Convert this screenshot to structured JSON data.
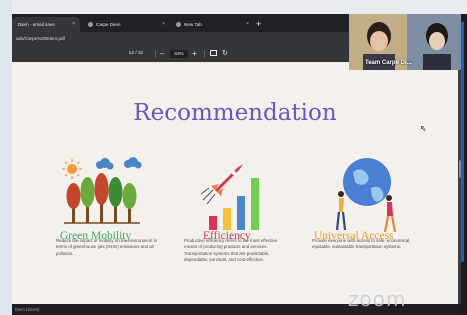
{
  "browser": {
    "tabs": [
      {
        "label": "Diem - email save",
        "active": true
      },
      {
        "label": "Carpe Diem",
        "active": false
      },
      {
        "label": "New Tab",
        "active": false
      }
    ],
    "address": "ads/Carpe%20Diem.pdf"
  },
  "pdf_toolbar": {
    "page": "12 / 31",
    "zoom": "63%"
  },
  "slide": {
    "title": "Recommendation",
    "columns": [
      {
        "heading": "Green Mobility",
        "heading_color": "#3aa676",
        "text": "Reduce the impact of mobility on the environment in terms of greenhouse gas (GHG) emissions and air pollution."
      },
      {
        "heading": "Efficiency",
        "heading_color": "#d8345a",
        "text": "Productive efficiency refers to the most effective means of producing products and services. Transportation systems that are predictable, dependable, punctual, and cost-effective."
      },
      {
        "heading": "Universal Access",
        "heading_color": "#e0a02a",
        "text": "Provide everyone with access to safe, economical, equitable, sustainable transportation systems."
      }
    ]
  },
  "video": {
    "participant_name": "Team Carpe Di..."
  },
  "taskbar": {
    "text": "Diem (Zoom)"
  },
  "watermark": "zoom",
  "colors": {
    "title": "#6b55c6",
    "slide_background": "#f4f1ed"
  }
}
